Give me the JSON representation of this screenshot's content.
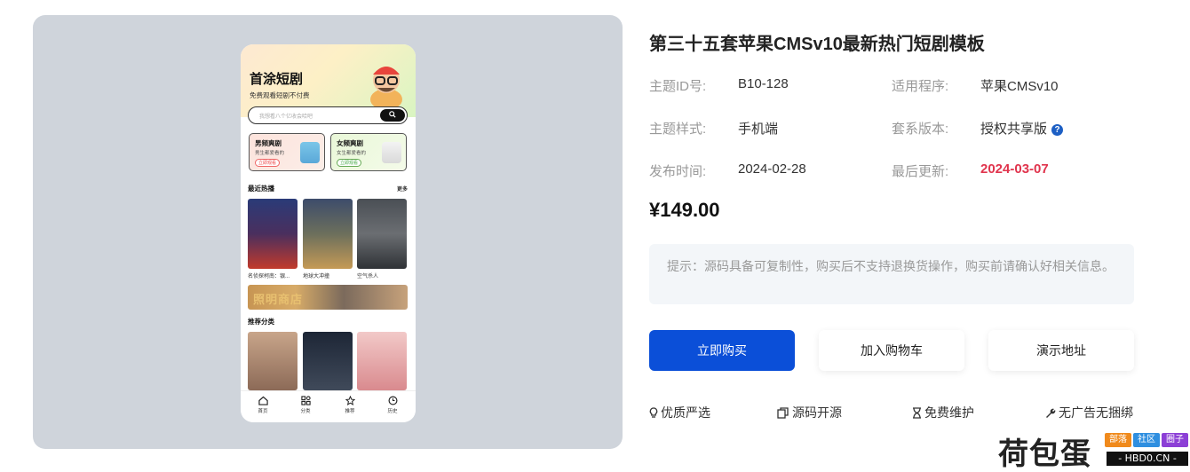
{
  "phone": {
    "app_title": "首涂短剧",
    "app_subtitle": "免费观看短剧不付费",
    "search_placeholder": "我想看八个亿收会哈吧",
    "promo_male": {
      "title": "男频爽剧",
      "desc": "男生都爱看的",
      "button": "立即观看"
    },
    "promo_female": {
      "title": "女频爽剧",
      "desc": "女生都爱看的",
      "button": "立即观看"
    },
    "recent_heading": "最近热播",
    "more_label": "更多",
    "recent_items": [
      {
        "caption": "名侦探柯南：银..."
      },
      {
        "caption": "地球大冲撞"
      },
      {
        "caption": "空气杀人"
      }
    ],
    "banner_text": "照明商店",
    "recommend_heading": "推荐分类",
    "tabs": [
      {
        "label": "首页",
        "icon": "home-icon"
      },
      {
        "label": "分类",
        "icon": "category-icon"
      },
      {
        "label": "推荐",
        "icon": "star-icon"
      },
      {
        "label": "历史",
        "icon": "clock-icon"
      }
    ]
  },
  "product": {
    "title": "第三十五套苹果CMSv10最新热门短剧模板",
    "theme_id_label": "主题ID号:",
    "theme_id": "B10-128",
    "program_label": "适用程序:",
    "program": "苹果CMSv10",
    "style_label": "主题样式:",
    "style": "手机端",
    "version_label": "套系版本:",
    "version": "授权共享版",
    "publish_label": "发布时间:",
    "publish_date": "2024-02-28",
    "update_label": "最后更新:",
    "update_date": "2024-03-07",
    "price": "¥149.00",
    "notice": "提示：源码具备可复制性，购买后不支持退换货操作，购买前请确认好相关信息。",
    "accent_color": "#0b4fd8",
    "update_color": "#e0344d"
  },
  "actions": {
    "buy": "立即购买",
    "cart": "加入购物车",
    "demo": "演示地址"
  },
  "features": [
    {
      "label": "优质严选",
      "icon": "lightbulb-icon"
    },
    {
      "label": "源码开源",
      "icon": "copy-icon"
    },
    {
      "label": "免费维护",
      "icon": "hourglass-icon"
    },
    {
      "label": "无广告无捆绑",
      "icon": "wrench-icon"
    }
  ],
  "watermark": {
    "text": "荷包蛋",
    "tags": [
      "部落",
      "社区",
      "圈子"
    ],
    "url": "- HBD0.CN -"
  }
}
